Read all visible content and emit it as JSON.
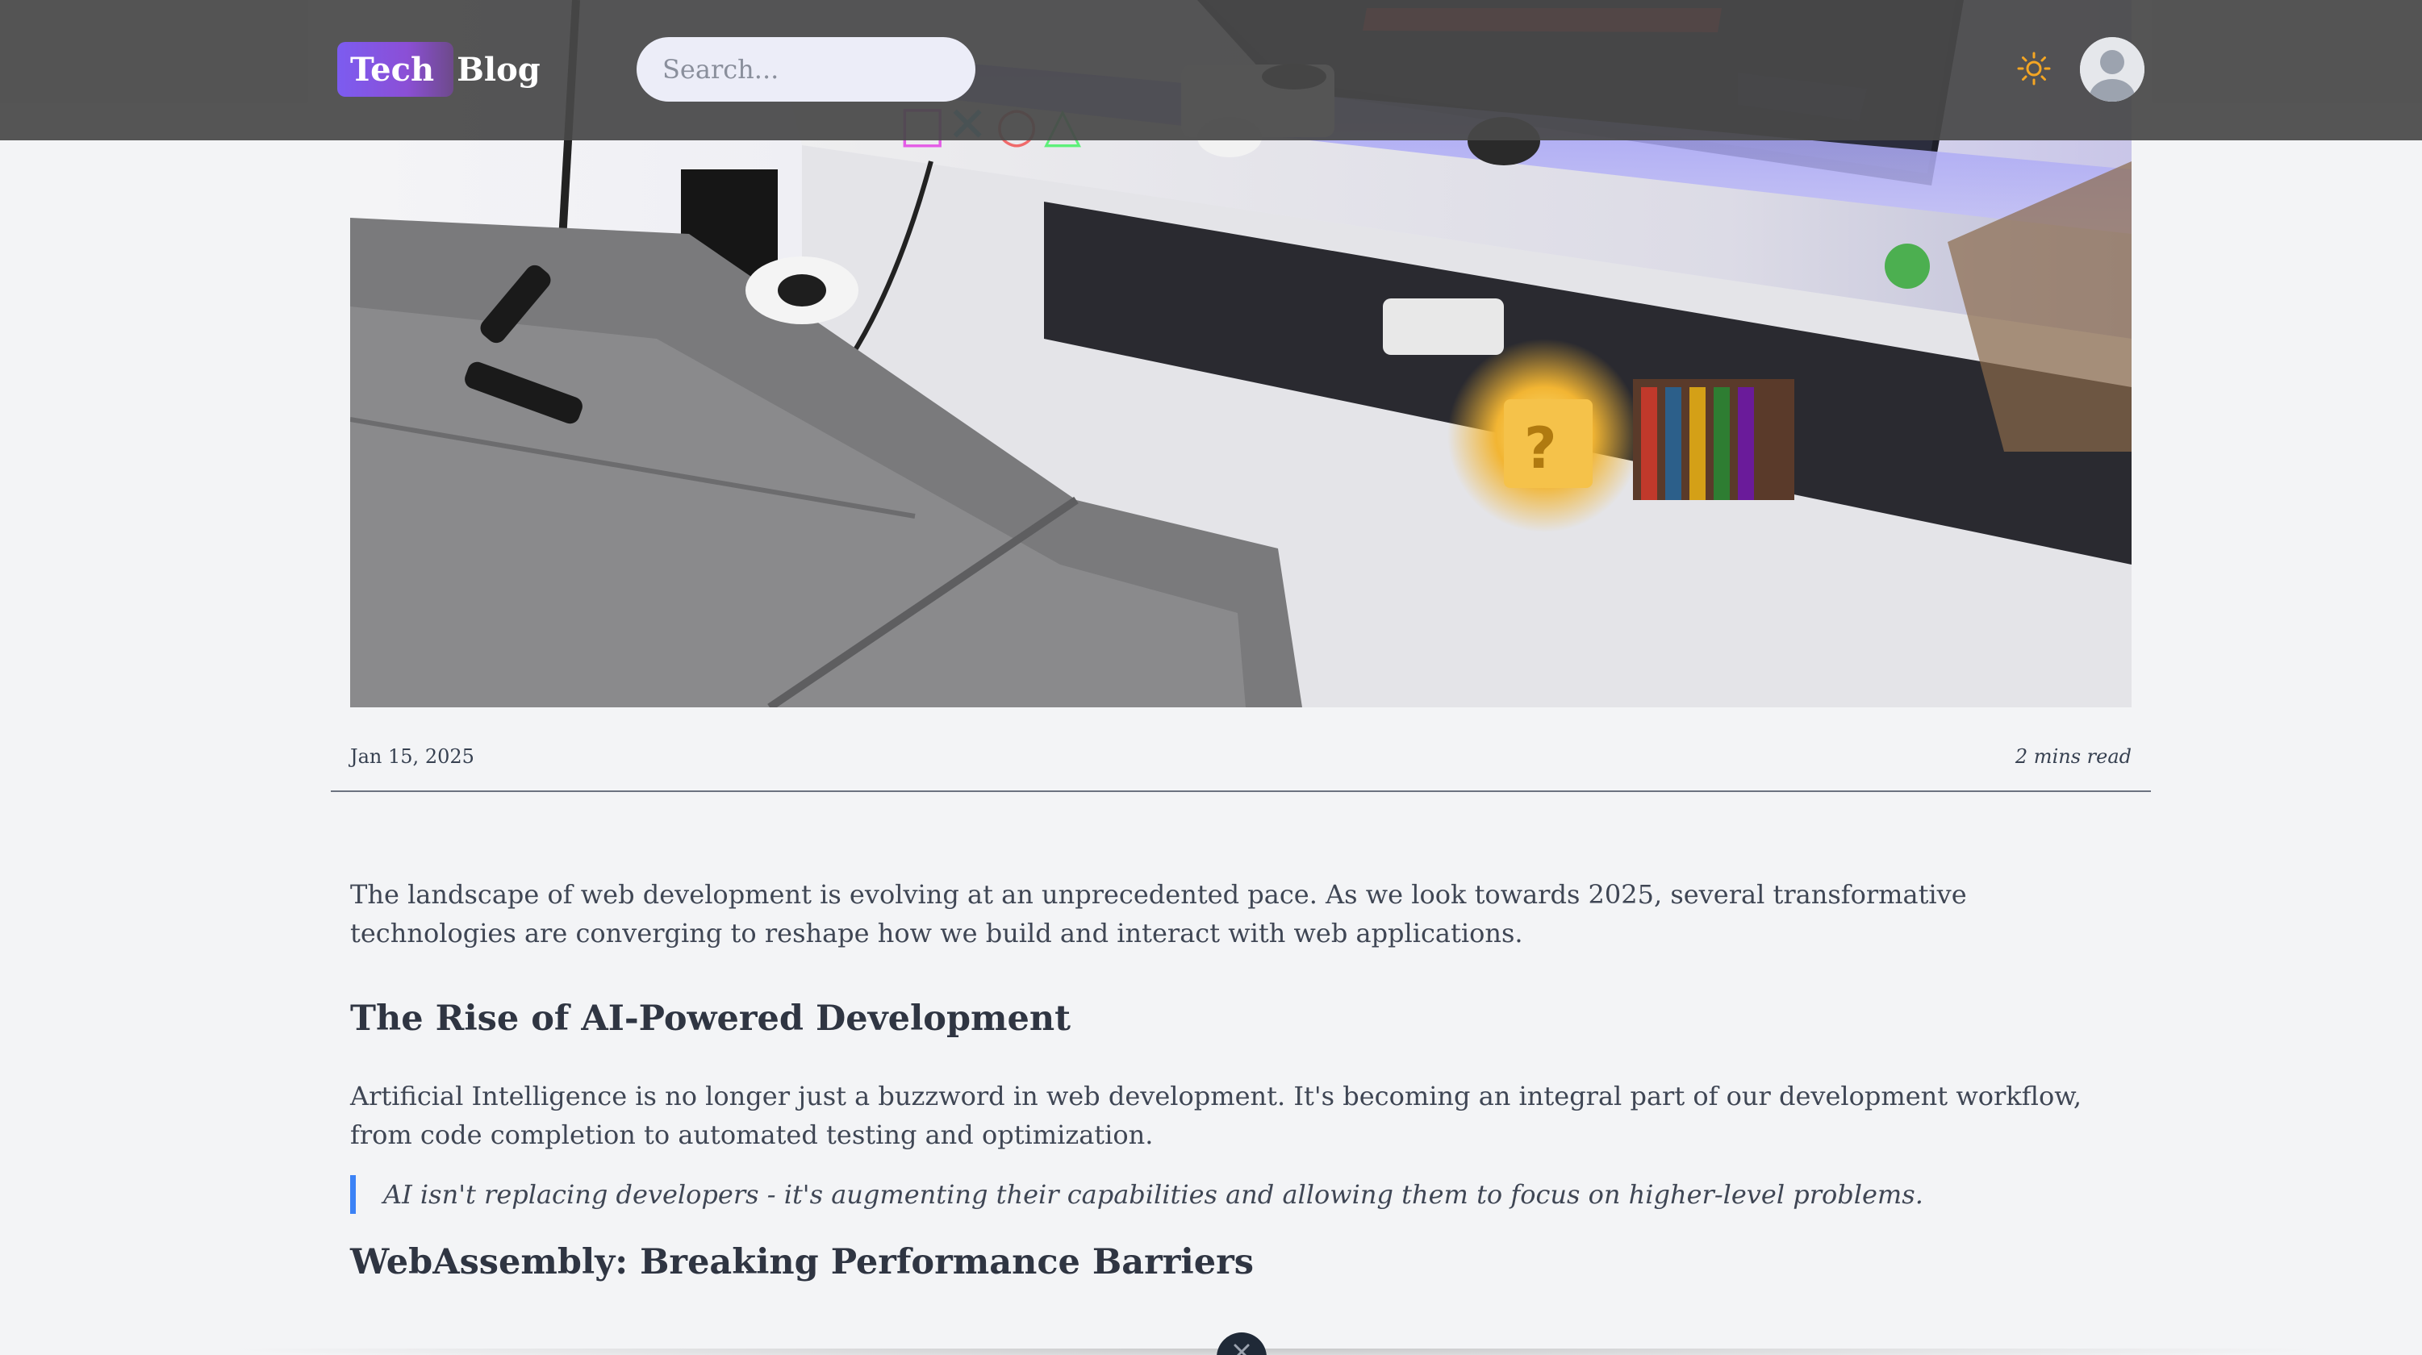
{
  "header": {
    "logo_badge": "Tech",
    "logo_text": "Blog",
    "search_placeholder": "Search...",
    "theme_icon": "sun-icon",
    "avatar_icon": "user-avatar-icon"
  },
  "post": {
    "date": "Jan 15, 2025",
    "read_time": "2 mins read",
    "paragraphs": [
      "The landscape of web development is evolving at an unprecedented pace. As we look towards 2025, several transformative technologies are converging to reshape how we build and interact with web applications.",
      "Artificial Intelligence is no longer just a buzzword in web development. It's becoming an integral part of our development workflow, from code completion to automated testing and optimization."
    ],
    "headings": [
      "The Rise of AI-Powered Development",
      "WebAssembly: Breaking Performance Barriers"
    ],
    "quote": "AI isn't replacing developers - it's augmenting their capabilities and allowing them to focus on higher-level problems."
  },
  "colors": {
    "accent_quote": "#3b82f6",
    "header_bg": "#484848",
    "logo_gradient_start": "#7c5cf0",
    "page_bg": "#f3f4f6"
  }
}
